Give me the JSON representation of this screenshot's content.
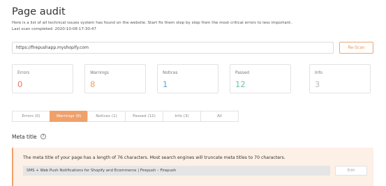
{
  "header": {
    "title": "Page audit",
    "description": "Here is a list of all technical issues system has found on the website. Start fix them step by step from the most critical errors to less important.",
    "last_scan": "Last scan completed: 2020-10-08 17:30:47"
  },
  "scan": {
    "url": "https://firepushapp.myshopify.com",
    "rescan_label": "Re-Scan"
  },
  "stats": [
    {
      "label": "Errors",
      "value": "0",
      "color": "#e8715e"
    },
    {
      "label": "Warnings",
      "value": "8",
      "color": "#f0a06a"
    },
    {
      "label": "Notices",
      "value": "1",
      "color": "#5aa7e0"
    },
    {
      "label": "Passed",
      "value": "12",
      "color": "#6cc6a0"
    },
    {
      "label": "Info",
      "value": "3",
      "color": "#bdbdbd"
    }
  ],
  "tabs": [
    {
      "label": "Errors (0)",
      "active": false
    },
    {
      "label": "Warnings (8)",
      "active": true
    },
    {
      "label": "Notices (1)",
      "active": false
    },
    {
      "label": "Passed (12)",
      "active": false
    },
    {
      "label": "Info (3)",
      "active": false
    },
    {
      "label": "All",
      "active": false
    }
  ],
  "section": {
    "title": "Meta title",
    "help_icon": "?",
    "message": "The meta title of your page has a length of 76 characters. Most search engines will truncate meta titles to 70 characters.",
    "meta_title_value": "SMS + Web Push Notifications for Shopify and Ecommerce | Firepush – Firepush",
    "edit_label": "Edit"
  },
  "colors": {
    "accent": "#f0a06a"
  }
}
